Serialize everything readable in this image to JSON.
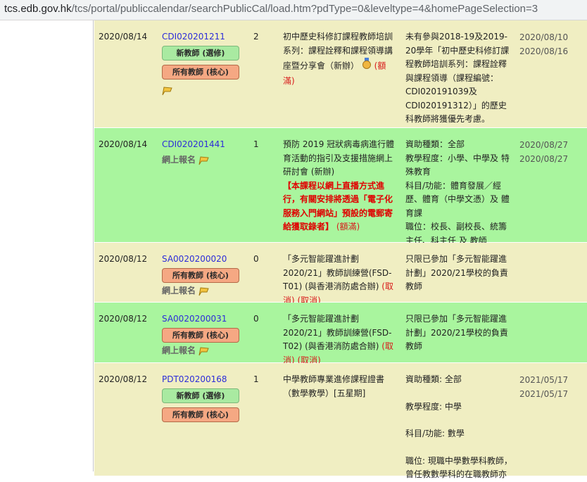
{
  "browser": {
    "url_host": "tcs.edb.gov.hk",
    "url_path": "/tcs/portal/publiccalendar/searchPublicCal/load.htm?pdType=0&leveltype=4&homePageSelection=3"
  },
  "rows": [
    {
      "date": "2020/08/14",
      "code": "CDI020201211",
      "tags": [
        "新教師 (選修)",
        "所有教師 (核心)"
      ],
      "count": "2",
      "title": "初中歷史科修訂課程教師培訓系列：課程詮釋和課程領導講座暨分享會（新辦）",
      "status": "(額滿)",
      "desc": "未有參與2018-19及2019-20學年「初中歷史科修訂課程教師培訓系列：課程詮釋與課程領導（課程編號：CDI020191039及CDI020191312）」的歷史科教師將獲優先考慮。",
      "date_from": "2020/08/10",
      "date_to": "2020/08/16"
    },
    {
      "date": "2020/08/14",
      "code": "CDI020201441",
      "online_label": "網上報名",
      "count": "1",
      "title": "預防 2019 冠狀病毒病進行體育活動的指引及支援措施網上研討會 (新辦)",
      "notice": "【本課程以網上直播方式進行，有關安排將透過「電子化服務入門網站」預設的電郵寄給獲取錄者】",
      "status": "(額滿)",
      "desc_lines": [
        "資助種類：全部",
        "教學程度：小學、中學及 特殊教育",
        "科目/功能：體育發展／經歷、體育（中學文憑）及 體育課",
        "職位：校長、副校長、統籌主任、科主任 及 教師"
      ],
      "date_from": "2020/08/27",
      "date_to": "2020/08/27"
    },
    {
      "date": "2020/08/12",
      "code": "SA0020200020",
      "tags": [
        "所有教師 (核心)"
      ],
      "online_label": "網上報名",
      "count": "0",
      "title": "「多元智能躍進計劃2020/21」教師訓練營(FSD-T01) (與香港消防處合辦)",
      "status": "(取消) (取消)",
      "desc": "只限已參加「多元智能躍進計劃」2020/21學校的負責教師"
    },
    {
      "date": "2020/08/12",
      "code": "SA0020200031",
      "tags": [
        "所有教師 (核心)"
      ],
      "online_label": "網上報名",
      "count": "0",
      "title": "「多元智能躍進計劃2020/21」教師訓練營(FSD-T02) (與香港消防處合辦)",
      "status": "(取消) (取消)",
      "desc": "只限已參加「多元智能躍進計劃」2020/21學校的負責教師"
    },
    {
      "date": "2020/08/12",
      "code": "PDT020200168",
      "tags": [
        "新教師 (選修)",
        "所有教師 (核心)"
      ],
      "count": "1",
      "title": "中學教師專業進修課程證書（數學教學）[五星期]",
      "desc_lines": [
        "資助種類: 全部",
        "教學程度: 中學",
        "科目/功能: 數學",
        "職位: 現職中學數學科教師，曾任教數學科的在職教師亦"
      ],
      "date_from": "2021/05/17",
      "date_to": "2021/05/17"
    }
  ]
}
